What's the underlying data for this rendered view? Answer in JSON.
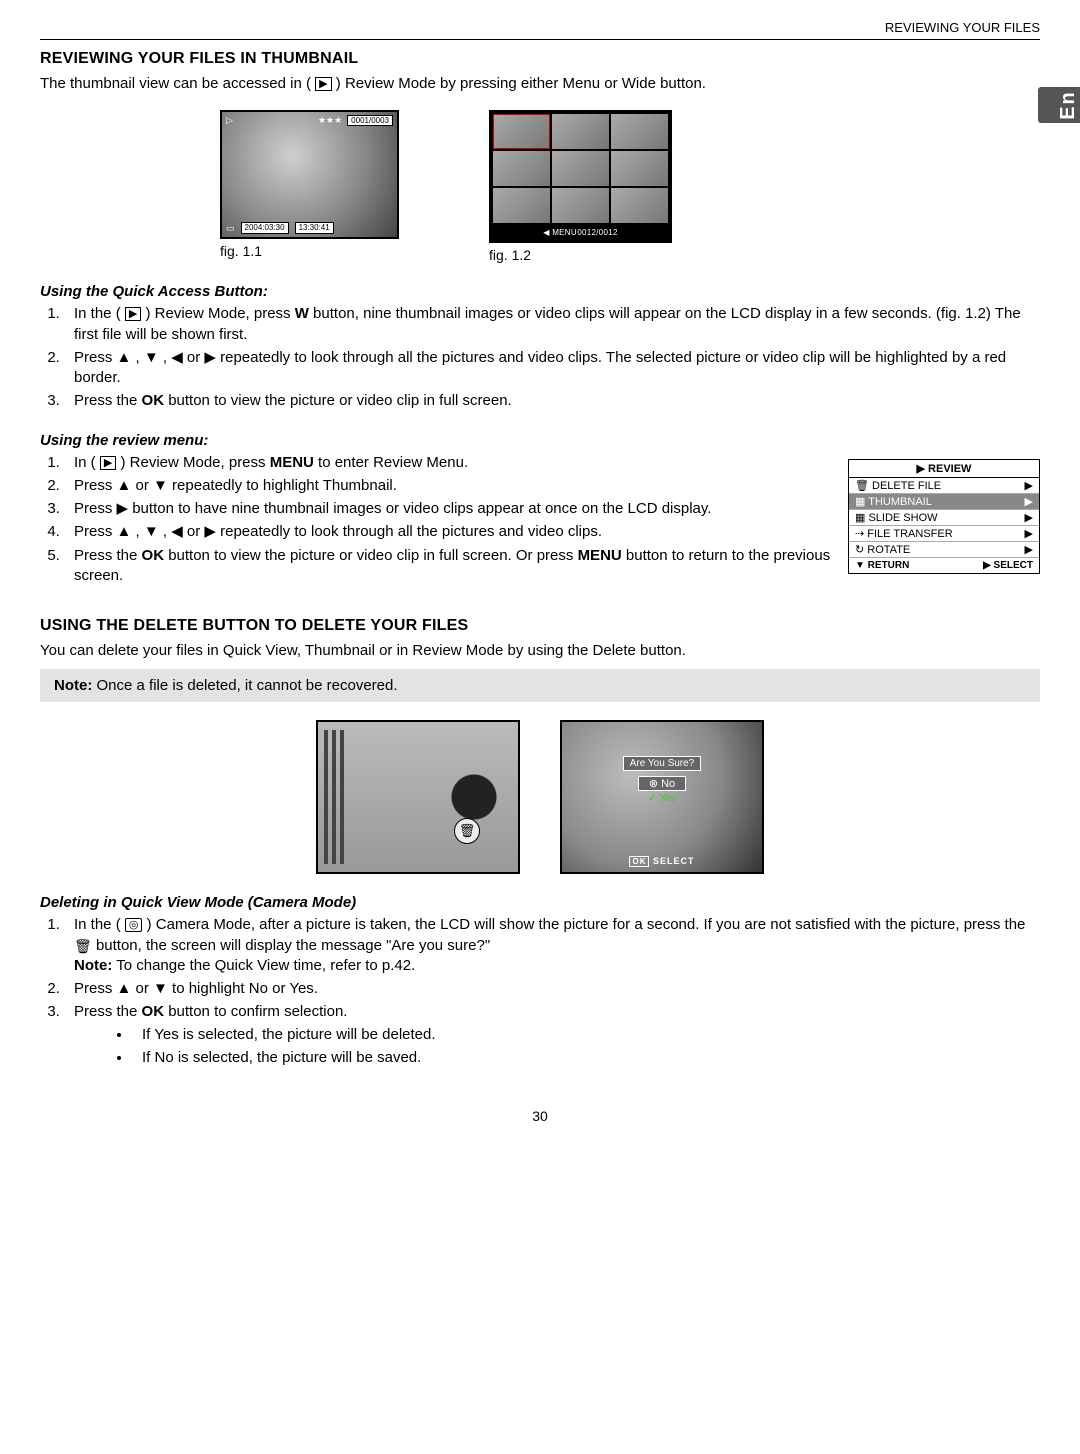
{
  "header": {
    "running_head": "REVIEWING YOUR FILES",
    "lang_tab": "En",
    "page_number": "30"
  },
  "section1": {
    "title": "REVIEWING YOUR FILES IN THUMBNAIL",
    "intro_a": "The thumbnail view can be accessed in ( ",
    "intro_b": " ) Review Mode by pressing either Menu or Wide button."
  },
  "fig11": {
    "counter": "0001/0003",
    "stars": "★★★",
    "date": "2004:03:30",
    "time": "13:30:41",
    "caption": "fig. 1.1"
  },
  "fig12": {
    "bottom": "◀ MENU\u00030012/0012",
    "caption": "fig. 1.2"
  },
  "quick": {
    "heading": "Using the Quick Access Button:",
    "s1a": "In the ( ",
    "s1b": " ) Review Mode, press ",
    "s1_bold": "W",
    "s1c": " button, nine thumbnail images or video clips will appear on the LCD display in a few seconds. (fig. 1.2) The first file will be shown first.",
    "s2": "Press  ▲  ,  ▼  ,  ◀  or  ▶   repeatedly to look through all the pictures and video clips. The selected picture or video clip will be highlighted by a red border.",
    "s3a": "Press the ",
    "s3_bold": "OK",
    "s3b": " button to view the picture or video clip in full screen."
  },
  "menu_screen": {
    "title": "▶ REVIEW",
    "items": [
      "DELETE FILE",
      "THUMBNAIL",
      "SLIDE SHOW",
      "FILE TRANSFER",
      "ROTATE"
    ],
    "selected_index": 1,
    "footer_left": "▼  RETURN\u0003 ◀",
    "footer_right": "▶  SELECT"
  },
  "review": {
    "heading": "Using the review menu:",
    "s1a": "In ( ",
    "s1b": " ) Review Mode, press ",
    "s1_bold": "MENU",
    "s1c": " to enter Review Menu.",
    "s2": "Press  ▲  or  ▼  repeatedly to highlight Thumbnail.",
    "s3": "Press  ▶  button to have nine thumbnail images or video clips appear at once on the LCD display.",
    "s4": "Press  ▲  ,  ▼  ,  ◀  or  ▶   repeatedly to look through all the pictures and video clips.",
    "s5a": "Press the ",
    "s5_bold1": "OK",
    "s5b": " button to view the picture or video clip in full screen. Or press ",
    "s5_bold2": "MENU",
    "s5c": " button to return to the previous screen."
  },
  "section2": {
    "title": "USING THE DELETE BUTTON TO DELETE YOUR FILES",
    "intro": "You can delete your files in Quick View, Thumbnail or in Review Mode by using the Delete button.",
    "note_bold": "Note:",
    "note_text": " Once a file is deleted, it cannot be recovered."
  },
  "confirm": {
    "prompt": "Are You Sure?",
    "no": "⊗ No",
    "yes": "✓ Yes",
    "select": "SELECT",
    "ok": "OK"
  },
  "delqv": {
    "heading": "Deleting in Quick View Mode (Camera Mode)",
    "s1a": "In the ( ",
    "s1b": " ) Camera Mode, after a picture is taken, the LCD will show the picture for a second. If you are not satisfied with the picture, press the  ",
    "s1c": "  button, the screen will display the message \"Are you sure?\"",
    "s1_note_bold": "Note:",
    "s1_note": " To change the Quick View time, refer to p.42.",
    "s2": "Press  ▲  or  ▼  to highlight No or Yes.",
    "s3a": "Press the ",
    "s3_bold": "OK",
    "s3b": " button to confirm selection.",
    "b1": "If Yes is selected, the picture will be deleted.",
    "b2": "If No is selected, the picture will be saved."
  },
  "icons": {
    "play": "▶",
    "camera": "◎",
    "trash": "🗑"
  }
}
